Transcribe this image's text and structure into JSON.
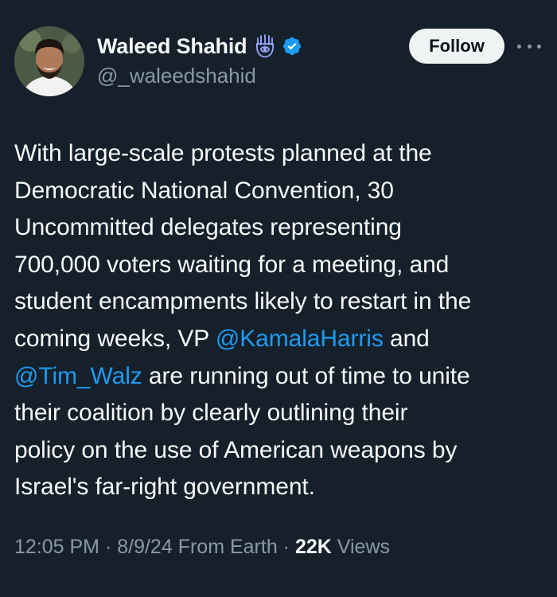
{
  "author": {
    "display_name": "Waleed Shahid",
    "handle": "@_waleedshahid",
    "emoji_icon": "hamsa-icon",
    "verified_icon": "verified-badge-icon"
  },
  "follow_button": {
    "label": "Follow"
  },
  "more_menu_icon": "more-horizontal-icon",
  "tweet": {
    "line_1": "With large-scale protests planned at the",
    "line_2": "Democratic National Convention, 30",
    "line_3": "Uncommitted delegates representing",
    "line_4": "700,000 voters waiting for a meeting, and",
    "line_5": "student encampments likely to restart in the",
    "line_6_before": "coming weeks, VP ",
    "mention_1": "@KamalaHarris",
    "line_6_after": " and",
    "mention_2": "@Tim_Walz",
    "line_7_after": " are running out of time to unite",
    "line_8": "their coalition by clearly outlining their",
    "line_9": "policy on the use of American weapons by",
    "line_10": "Israel's far-right government."
  },
  "meta": {
    "time": "12:05 PM",
    "separator_1": " · ",
    "date": "8/9/24",
    "source": " From Earth",
    "separator_2": " · ",
    "views_count": "22K",
    "views_label": " Views"
  },
  "colors": {
    "background": "#15202b",
    "text": "#f7f9f9",
    "secondary_text": "#8b98a5",
    "link": "#1d9bf0",
    "verified": "#1d9bf0",
    "follow_bg": "#eff3f4"
  }
}
